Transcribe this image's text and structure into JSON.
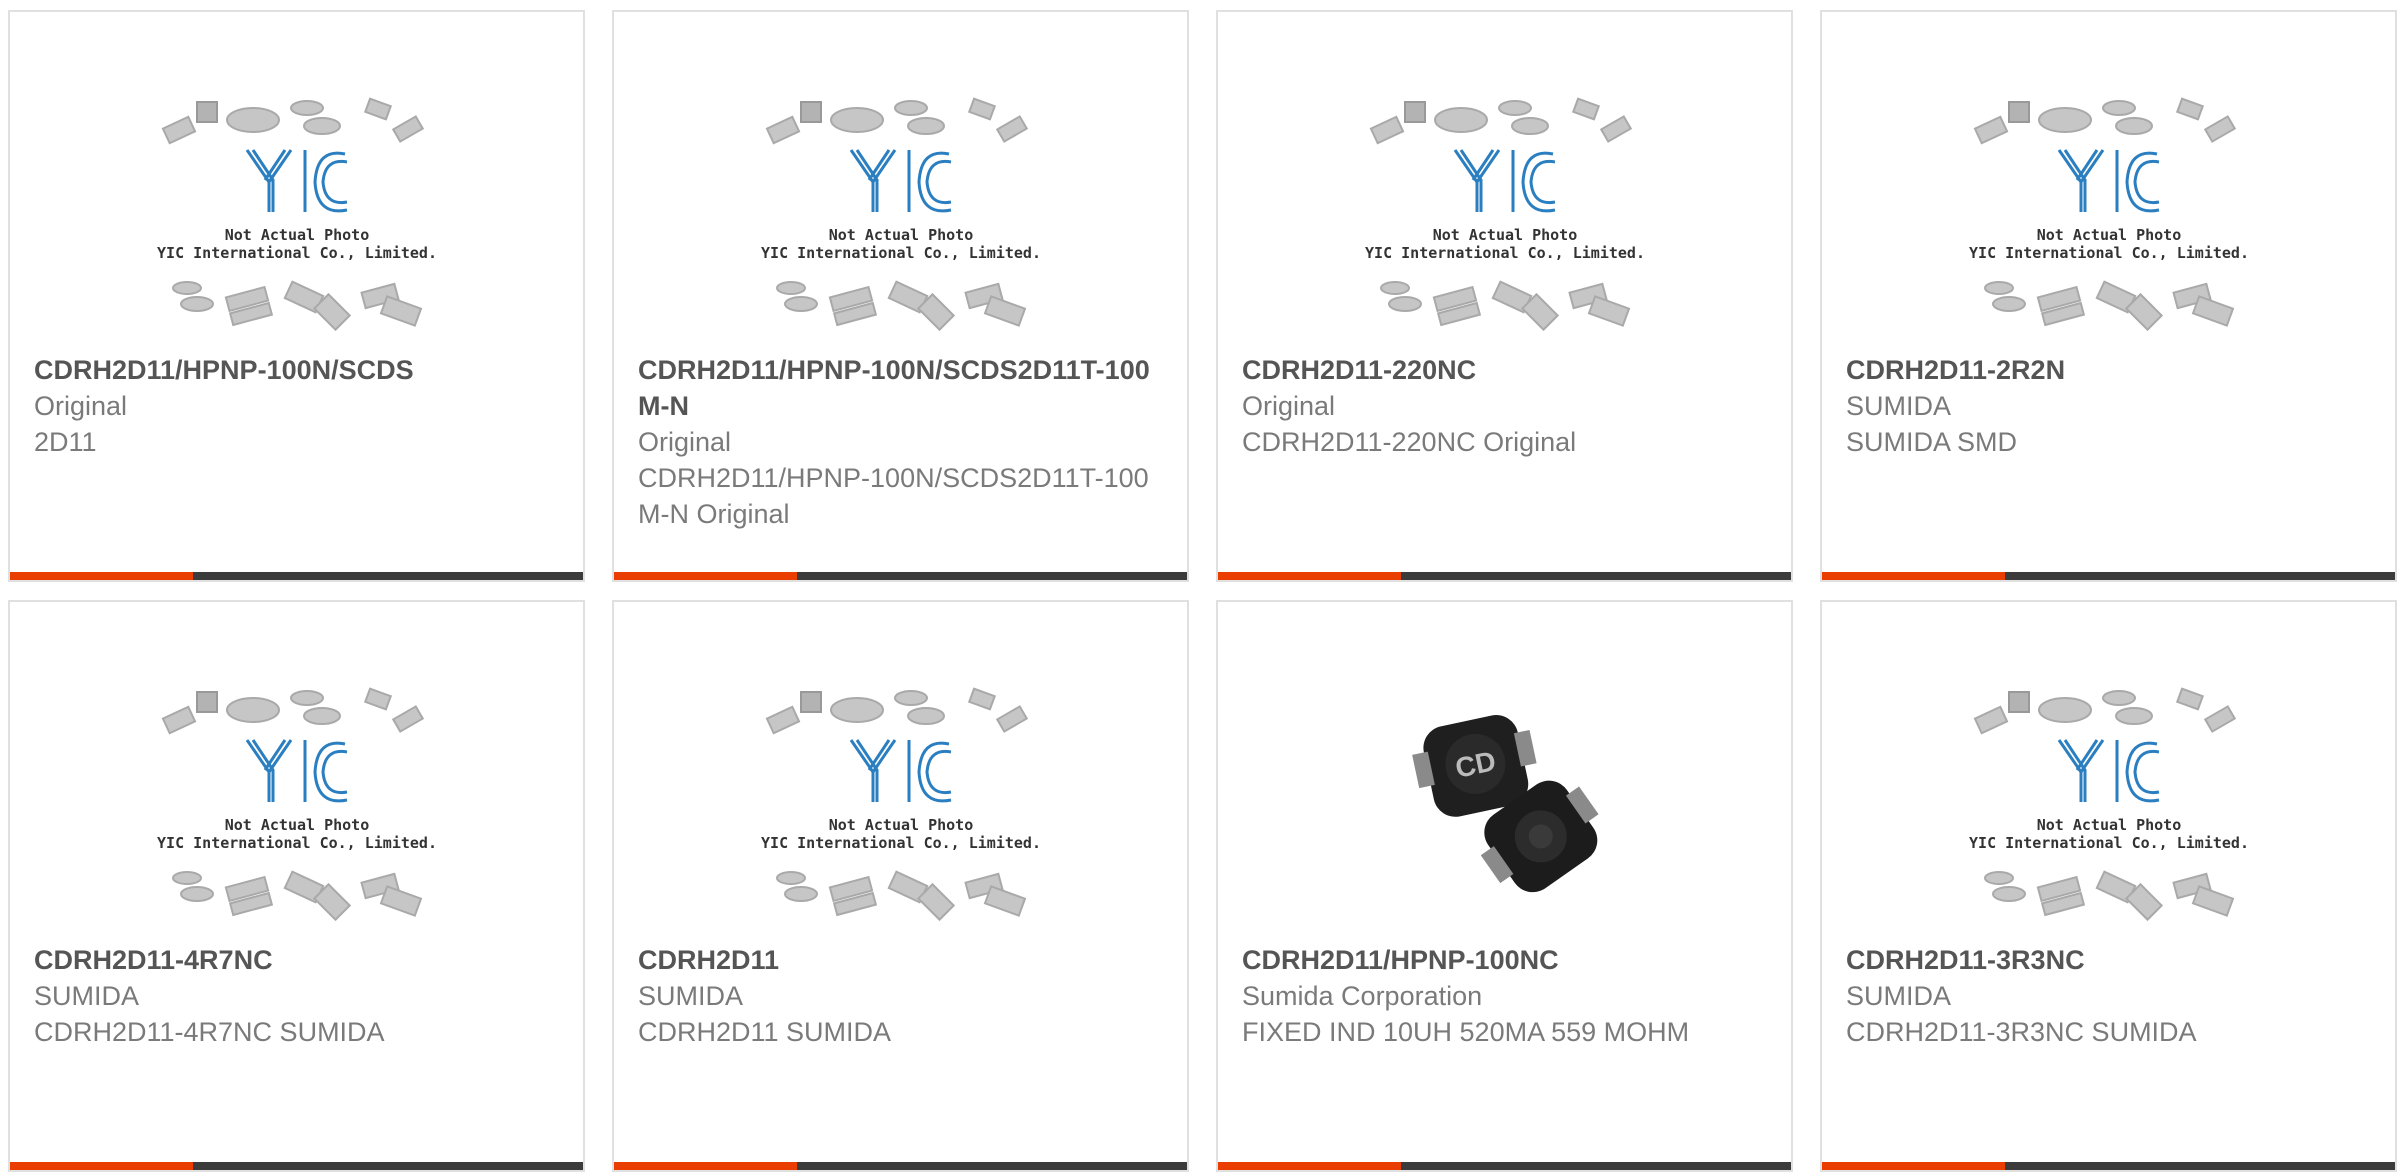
{
  "placeholder": {
    "brand": "YIC",
    "note_line1": "Not Actual Photo",
    "note_line2": "YIC International Co., Limited."
  },
  "accent_color": "#ea3d00",
  "bar_color": "#3b3b3b",
  "products": [
    {
      "title": "CDRH2D11/HPNP-100N/SCDS",
      "lines": [
        "Original",
        "2D11"
      ],
      "image": "placeholder"
    },
    {
      "title": "CDRH2D11/HPNP-100N/SCDS2D11T-100M-N",
      "lines": [
        "Original",
        "CDRH2D11/HPNP-100N/SCDS2D11T-100M-N Original"
      ],
      "image": "placeholder"
    },
    {
      "title": "CDRH2D11-220NC",
      "lines": [
        "Original",
        "CDRH2D11-220NC Original"
      ],
      "image": "placeholder"
    },
    {
      "title": "CDRH2D11-2R2N",
      "lines": [
        "SUMIDA",
        "SUMIDA SMD"
      ],
      "image": "placeholder"
    },
    {
      "title": "CDRH2D11-4R7NC",
      "lines": [
        "SUMIDA",
        "CDRH2D11-4R7NC SUMIDA"
      ],
      "image": "placeholder"
    },
    {
      "title": "CDRH2D11",
      "lines": [
        "SUMIDA",
        "CDRH2D11 SUMIDA"
      ],
      "image": "placeholder"
    },
    {
      "title": "CDRH2D11/HPNP-100NC",
      "lines": [
        "Sumida Corporation",
        "FIXED IND 10UH 520MA 559 MOHM"
      ],
      "image": "inductor-photo"
    },
    {
      "title": "CDRH2D11-3R3NC",
      "lines": [
        "SUMIDA",
        "CDRH2D11-3R3NC SUMIDA"
      ],
      "image": "placeholder"
    }
  ]
}
